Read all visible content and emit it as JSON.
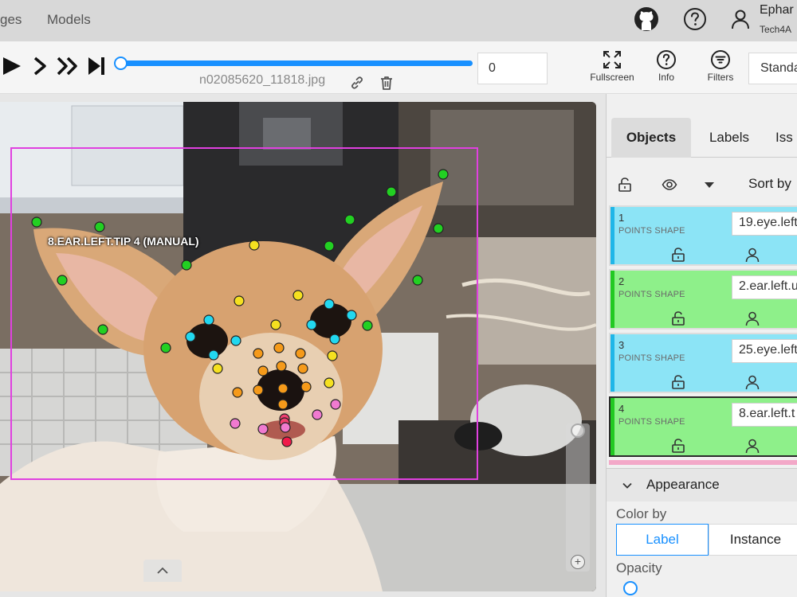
{
  "header": {
    "nav": [
      {
        "label": "ges"
      },
      {
        "label": "Models"
      }
    ],
    "github_icon": "github-icon",
    "help_icon": "question-circle-icon",
    "user_icon": "user-icon",
    "user": {
      "name": "Ephar",
      "org": "Tech4A"
    }
  },
  "player": {
    "frame_value": "0",
    "file_name": "n02085620_11818.jpg",
    "progress_percent": 0,
    "tools": [
      {
        "label": "Fullscreen",
        "icon": "fullscreen-icon"
      },
      {
        "label": "Info",
        "icon": "info-circle-icon"
      },
      {
        "label": "Filters",
        "icon": "filter-icon"
      }
    ],
    "workspace_select": "Standa"
  },
  "canvas": {
    "active_label": "8.EAR.LEFT.TIP 4 (MANUAL)",
    "bbox_color": "#e040e0"
  },
  "sidebar": {
    "tabs": [
      {
        "label": "Objects"
      },
      {
        "label": "Labels"
      },
      {
        "label": "Iss"
      }
    ],
    "sort_label": "Sort by",
    "objects": [
      {
        "id": "1",
        "type": "POINTS SHAPE",
        "label": "19.eye.left",
        "color": "#86e3f5"
      },
      {
        "id": "2",
        "type": "POINTS SHAPE",
        "label": "2.ear.left.u",
        "color": "#8ef08a"
      },
      {
        "id": "3",
        "type": "POINTS SHAPE",
        "label": "25.eye.left",
        "color": "#86e3f5"
      },
      {
        "id": "4",
        "type": "POINTS SHAPE",
        "label": "8.ear.left.t",
        "color": "#8ef08a"
      }
    ],
    "appearance": {
      "title": "Appearance",
      "color_by": "Color by",
      "options": [
        {
          "label": "Label"
        },
        {
          "label": "Instance"
        }
      ],
      "opacity": "Opacity"
    }
  }
}
